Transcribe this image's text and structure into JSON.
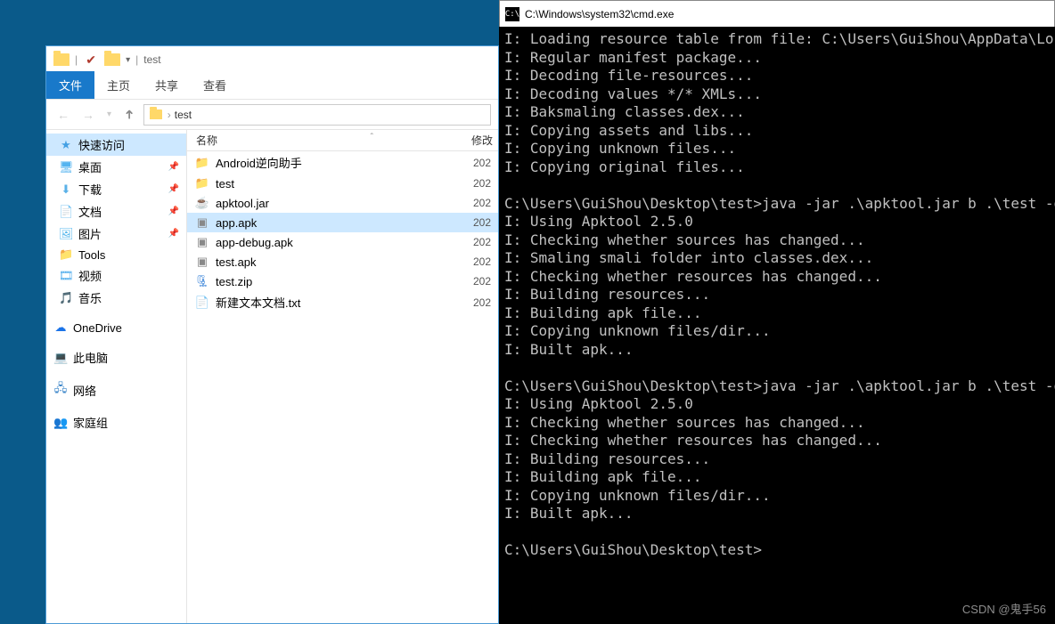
{
  "explorer": {
    "title": "test",
    "tabs": {
      "file": "文件",
      "home": "主页",
      "share": "共享",
      "view": "查看"
    },
    "breadcrumb": {
      "root": "test"
    },
    "columns": {
      "name": "名称",
      "date": "修改"
    },
    "sidebar": {
      "quick": "快速访问",
      "desktop": "桌面",
      "downloads": "下载",
      "documents": "文档",
      "pictures": "图片",
      "tools": "Tools",
      "videos": "视频",
      "music": "音乐",
      "onedrive": "OneDrive",
      "thispc": "此电脑",
      "network": "网络",
      "homegroup": "家庭组"
    },
    "files": [
      {
        "name": "Android逆向助手",
        "type": "folder",
        "date": "202"
      },
      {
        "name": "test",
        "type": "folder",
        "date": "202"
      },
      {
        "name": "apktool.jar",
        "type": "jar",
        "date": "202"
      },
      {
        "name": "app.apk",
        "type": "apk",
        "date": "202",
        "selected": true
      },
      {
        "name": "app-debug.apk",
        "type": "apk",
        "date": "202"
      },
      {
        "name": "test.apk",
        "type": "apk",
        "date": "202"
      },
      {
        "name": "test.zip",
        "type": "zip",
        "date": "202"
      },
      {
        "name": "新建文本文档.txt",
        "type": "txt",
        "date": "202"
      }
    ]
  },
  "cmd": {
    "title": "C:\\Windows\\system32\\cmd.exe",
    "lines": [
      "I: Loading resource table from file: C:\\Users\\GuiShou\\AppData\\Local\\a",
      "I: Regular manifest package...",
      "I: Decoding file-resources...",
      "I: Decoding values */* XMLs...",
      "I: Baksmaling classes.dex...",
      "I: Copying assets and libs...",
      "I: Copying unknown files...",
      "I: Copying original files...",
      "",
      "C:\\Users\\GuiShou\\Desktop\\test>java -jar .\\apktool.jar b .\\test -o app",
      "I: Using Apktool 2.5.0",
      "I: Checking whether sources has changed...",
      "I: Smaling smali folder into classes.dex...",
      "I: Checking whether resources has changed...",
      "I: Building resources...",
      "I: Building apk file...",
      "I: Copying unknown files/dir...",
      "I: Built apk...",
      "",
      "C:\\Users\\GuiShou\\Desktop\\test>java -jar .\\apktool.jar b .\\test -o app",
      "I: Using Apktool 2.5.0",
      "I: Checking whether sources has changed...",
      "I: Checking whether resources has changed...",
      "I: Building resources...",
      "I: Building apk file...",
      "I: Copying unknown files/dir...",
      "I: Built apk...",
      "",
      "C:\\Users\\GuiShou\\Desktop\\test>"
    ]
  },
  "watermark": "CSDN @鬼手56"
}
